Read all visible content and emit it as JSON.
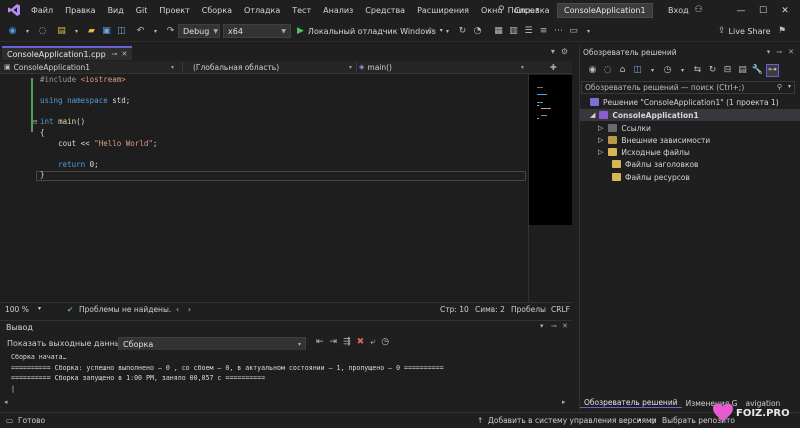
{
  "menu": {
    "items": [
      "Файл",
      "Правка",
      "Вид",
      "Git",
      "Проект",
      "Сборка",
      "Отладка",
      "Тест",
      "Анализ",
      "Средства",
      "Расширения",
      "Окно",
      "Справка"
    ],
    "search_label": "Поиск",
    "solution_name": "ConsoleApplication1",
    "login_label": "Вход"
  },
  "toolbar": {
    "config": "Debug",
    "platform": "x64",
    "debugger_label": "Локальный отладчик Windows",
    "live_share": "Live Share"
  },
  "editor": {
    "tab_name": "ConsoleApplication1.cpp",
    "nav_project": "ConsoleApplication1",
    "nav_scope": "(Глобальная область)",
    "nav_member": "main()",
    "code": {
      "line1_pp": "#include",
      "line1_rest": " <iostream>",
      "line2_kw1": "using",
      "line2_kw2": "namespace",
      "line2_rest": " std;",
      "line3_kw": "int",
      "line3_fn": "main",
      "line3_rest": "()",
      "line4": "{",
      "line5_a": "cout << ",
      "line5_str": "\"Hello World\"",
      "line5_b": ";",
      "line6_kw": "return",
      "line6_rest": " 0;",
      "line7": "}"
    },
    "status": {
      "zoom": "100 %",
      "problems": "Проблемы не найдены.",
      "line": "Стр: 10",
      "col": "Симв: 2",
      "spaces": "Пробелы",
      "eol": "CRLF"
    }
  },
  "output": {
    "title": "Вывод",
    "show_from_label": "Показать выходные данные из:",
    "source": "Сборка",
    "lines": [
      "Сборка начата…",
      "========== Сборка: успешно выполнено — 0 , со сбоем — 0, в актуальном состоянии — 1, пропущено — 0 ==========",
      "========== Сборка запущено в 1:00 PM, заняло 00,057 с =========="
    ]
  },
  "solution_explorer": {
    "title": "Обозреватель решений",
    "search_placeholder": "Обозреватель решений — поиск (Ctrl+;)",
    "tree": [
      "Решение \"ConsoleApplication1\" (1 проекта 1)",
      "ConsoleApplication1",
      "Ссылки",
      "Внешние зависимости",
      "Исходные файлы",
      "Файлы заголовков",
      "Файлы ресурсов"
    ],
    "tab_active": "Обозреватель решений",
    "tab_other": "Изменения G",
    "tab_other2": "avigation"
  },
  "statusbar": {
    "ready": "Готово",
    "vcs": "Добавить в систему управления версиями",
    "repo": "Выбрать репозито"
  },
  "watermark": "FOIZ.PRO"
}
